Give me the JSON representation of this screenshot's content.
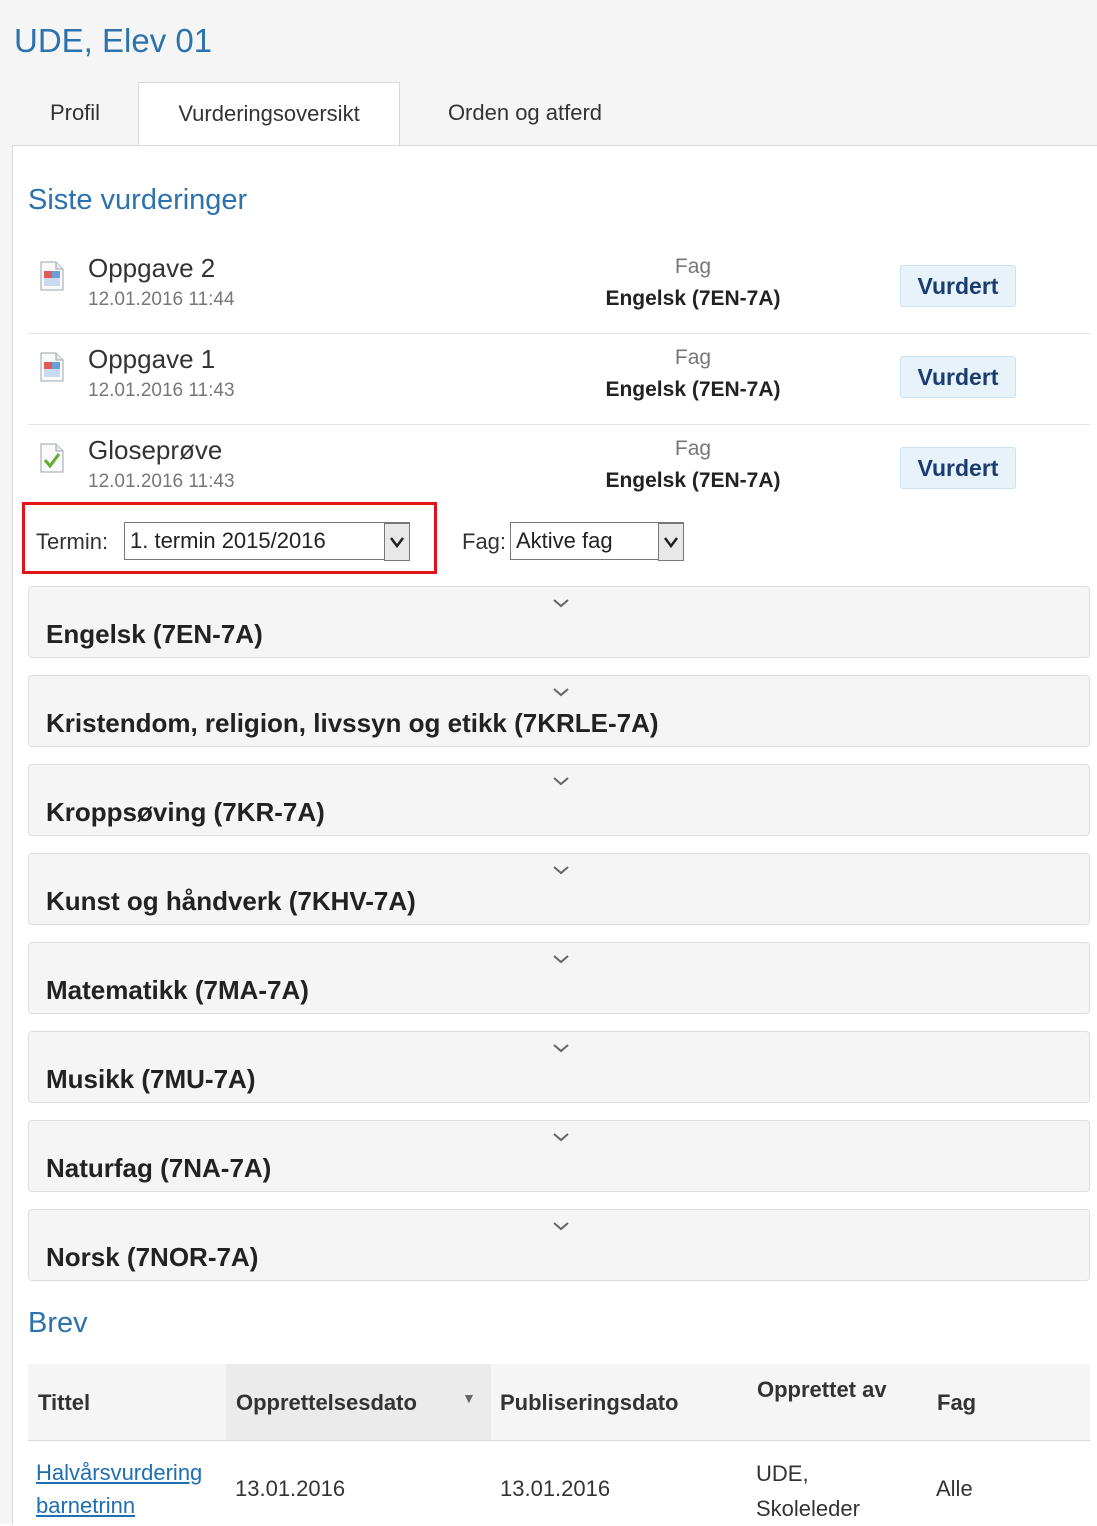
{
  "student_name": "UDE, Elev 01",
  "tabs": [
    "Profil",
    "Vurderingsoversikt",
    "Orden og atferd"
  ],
  "recent": {
    "heading": "Siste vurderinger",
    "items": [
      {
        "title": "Oppgave 2",
        "date": "12.01.2016 11:44",
        "fag_label": "Fag",
        "fag": "Engelsk (7EN-7A)",
        "status": "Vurdert",
        "icon": "document-icon"
      },
      {
        "title": "Oppgave 1",
        "date": "12.01.2016 11:43",
        "fag_label": "Fag",
        "fag": "Engelsk (7EN-7A)",
        "status": "Vurdert",
        "icon": "document-icon"
      },
      {
        "title": "Gloseprøve",
        "date": "12.01.2016 11:43",
        "fag_label": "Fag",
        "fag": "Engelsk (7EN-7A)",
        "status": "Vurdert",
        "icon": "checked-document-icon"
      }
    ]
  },
  "filters": {
    "termin_label": "Termin:",
    "termin_value": "1. termin 2015/2016",
    "fag_label": "Fag:",
    "fag_value": "Aktive fag"
  },
  "subjects": [
    "Engelsk (7EN-7A)",
    "Kristendom, religion, livssyn og etikk (7KRLE-7A)",
    "Kroppsøving (7KR-7A)",
    "Kunst og håndverk (7KHV-7A)",
    "Matematikk (7MA-7A)",
    "Musikk (7MU-7A)",
    "Naturfag (7NA-7A)",
    "Norsk (7NOR-7A)"
  ],
  "letters": {
    "heading": "Brev",
    "columns": [
      "Tittel",
      "Opprettelsesdato",
      "Publiseringsdato",
      "Opprettet av",
      "Fag"
    ],
    "sort_indicator": "▼",
    "rows": [
      {
        "title": "Halvårsvurdering barnetrinn",
        "created": "13.01.2016",
        "published": "13.01.2016",
        "created_by": "UDE, Skoleleder",
        "fag": "Alle"
      }
    ]
  },
  "colors": {
    "accent": "#2b72ae",
    "highlight": "#e0131a",
    "badge_bg": "#e8f2fb"
  }
}
